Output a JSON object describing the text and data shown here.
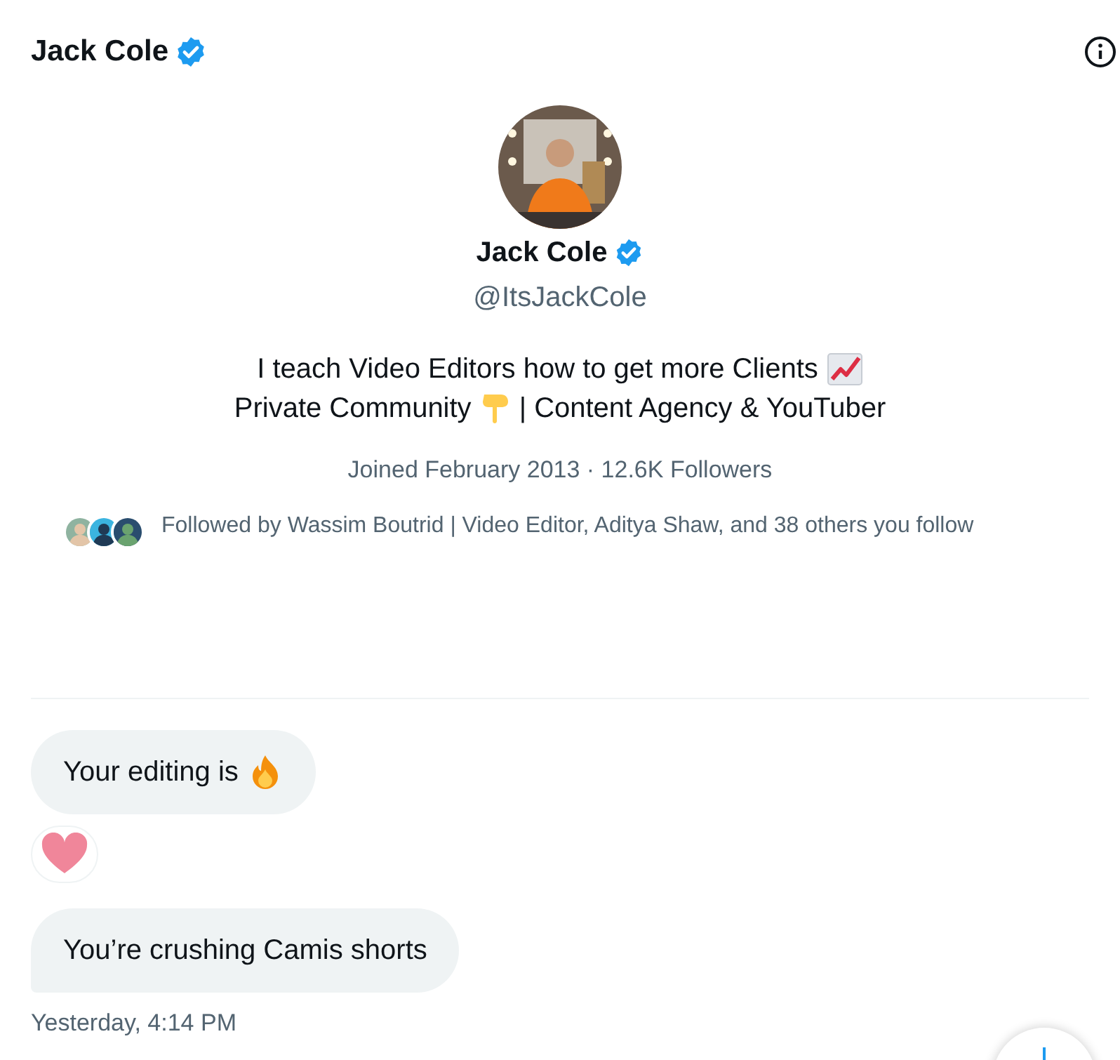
{
  "header": {
    "title": "Jack Cole",
    "verified": true
  },
  "profile": {
    "name": "Jack Cole",
    "verified": true,
    "handle": "@ItsJackCole",
    "bio": [
      [
        {
          "kind": "text",
          "text": "I teach Video Editors how to get more Clients"
        },
        {
          "kind": "chart"
        }
      ],
      [
        {
          "kind": "text",
          "text": "Private Community"
        },
        {
          "kind": "pointing-down"
        },
        {
          "kind": "text",
          "text": "| Content Agency & YouTuber"
        }
      ]
    ],
    "joined": "Joined February 2013 · 12.6K Followers",
    "followed_by": "Followed by Wassim Boutrid | Video Editor, Aditya Shaw, and 38 others you follow"
  },
  "messages": [
    {
      "parts": [
        {
          "kind": "text",
          "text": "Your editing is"
        },
        {
          "kind": "fire"
        }
      ],
      "reactions": [
        {
          "kind": "heart"
        }
      ]
    },
    {
      "parts": [
        {
          "kind": "text",
          "text": "You’re crushing Camis shorts"
        }
      ],
      "timestamp": "Yesterday, 4:14 PM"
    }
  ]
}
